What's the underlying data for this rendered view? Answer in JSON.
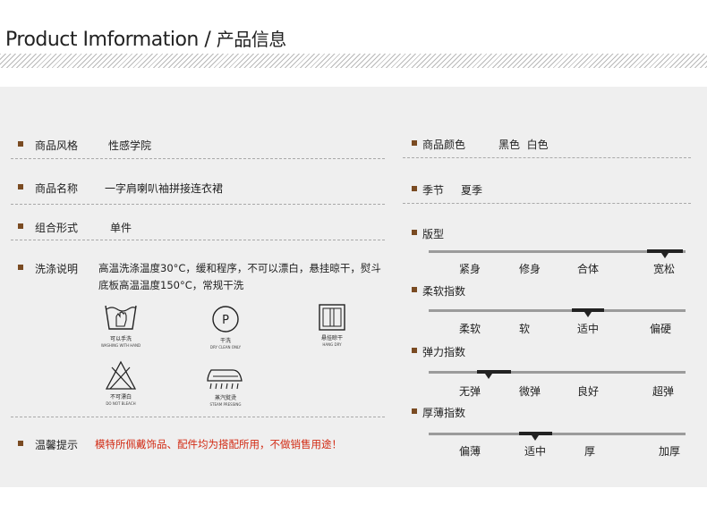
{
  "header": {
    "title_en": "Product Imformation",
    "title_sep": " / ",
    "title_cn": "产品信息"
  },
  "left": {
    "style": {
      "label": "商品风格",
      "value": "性感学院"
    },
    "name": {
      "label": "商品名称",
      "value": "一字肩喇叭袖拼接连衣裙"
    },
    "combo": {
      "label": "组合形式",
      "value": "单件"
    },
    "wash": {
      "label": "洗涤说明",
      "line1": "高温洗涤温度30°C，缓和程序，不可以漂白，悬挂晾干，熨斗",
      "line2": "底板高温温度150°C，常规干洗"
    },
    "care_icons": [
      {
        "icon": "hand-wash-icon",
        "cap1": "可以手洗",
        "cap2": "WASHING WITH HAND"
      },
      {
        "icon": "dry-clean-icon",
        "cap1": "干洗",
        "cap2": "DRY CLEAN ONLY",
        "letter": "P"
      },
      {
        "icon": "hang-dry-icon",
        "cap1": "悬挂晾干",
        "cap2": "HANG DRY"
      },
      {
        "icon": "no-bleach-icon",
        "cap1": "不可漂白",
        "cap2": "DO NOT BLEACH"
      },
      {
        "icon": "steam-iron-icon",
        "cap1": "蒸汽熨烫",
        "cap2": "STEAM PRESSING"
      }
    ],
    "tip": {
      "label": "温馨提示",
      "value": "模特所佩戴饰品、配件均为搭配所用，不做销售用途！"
    }
  },
  "right": {
    "color": {
      "label": "商品颜色",
      "value": "黑色  白色"
    },
    "season": {
      "label": "季节",
      "value": "夏季"
    },
    "scales": [
      {
        "label": "版型",
        "ticks": [
          "紧身",
          "修身",
          "合体",
          "宽松"
        ],
        "selected": "宽松"
      },
      {
        "label": "柔软指数",
        "ticks": [
          "柔软",
          "软",
          "适中",
          "偏硬"
        ],
        "selected": "适中"
      },
      {
        "label": "弹力指数",
        "ticks": [
          "无弹",
          "微弹",
          "良好",
          "超弹"
        ],
        "selected": "微弹"
      },
      {
        "label": "厚薄指数",
        "ticks": [
          "偏薄",
          "适中",
          "厚",
          "加厚"
        ],
        "selected": "适中"
      }
    ]
  },
  "colors": {
    "bullet": "#7a4b22",
    "warn": "#d22b14",
    "panel": "#efefef"
  }
}
